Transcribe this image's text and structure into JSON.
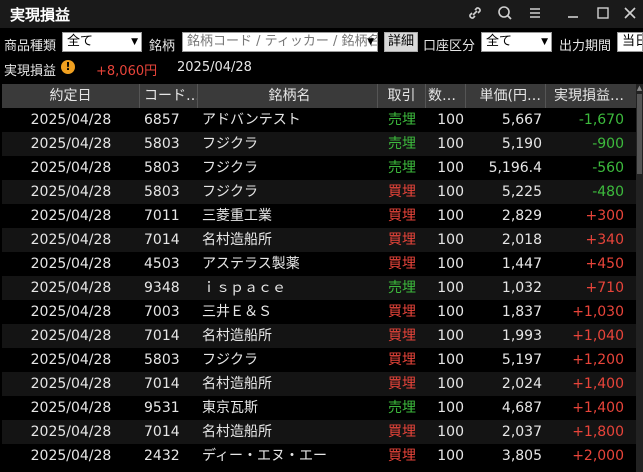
{
  "title": "実現損益",
  "filters": {
    "product_label": "商品種類",
    "product_value": "全て",
    "brand_label": "銘柄",
    "brand_placeholder": "銘柄コード / ティッカー / 銘柄名",
    "detail_button": "詳細",
    "account_label": "口座区分",
    "account_value": "全て",
    "period_label": "出力期間",
    "period_value": "当日"
  },
  "summary": {
    "label": "実現損益",
    "warning_glyph": "!",
    "value": "+8,060円",
    "date": "2025/04/28"
  },
  "columns": {
    "date": "約定日",
    "code": "コード…",
    "name": "銘柄名",
    "trade": "取引",
    "qty": "数…",
    "price": "単価(円…",
    "pl": "実現損益…"
  },
  "colors": {
    "sell": "#3dbb3d",
    "buy": "#e8443a",
    "loss": "#3dbb3d",
    "gain": "#e8443a"
  },
  "rows": [
    {
      "date": "2025/04/28",
      "code": "6857",
      "name": "アドバンテスト",
      "trade": "売埋",
      "qty": "100",
      "price": "5,667",
      "pl": "-1,670"
    },
    {
      "date": "2025/04/28",
      "code": "5803",
      "name": "フジクラ",
      "trade": "売埋",
      "qty": "100",
      "price": "5,190",
      "pl": "-900"
    },
    {
      "date": "2025/04/28",
      "code": "5803",
      "name": "フジクラ",
      "trade": "売埋",
      "qty": "100",
      "price": "5,196.4",
      "pl": "-560"
    },
    {
      "date": "2025/04/28",
      "code": "5803",
      "name": "フジクラ",
      "trade": "買埋",
      "qty": "100",
      "price": "5,225",
      "pl": "-480"
    },
    {
      "date": "2025/04/28",
      "code": "7011",
      "name": "三菱重工業",
      "trade": "買埋",
      "qty": "100",
      "price": "2,829",
      "pl": "+300"
    },
    {
      "date": "2025/04/28",
      "code": "7014",
      "name": "名村造船所",
      "trade": "買埋",
      "qty": "100",
      "price": "2,018",
      "pl": "+340"
    },
    {
      "date": "2025/04/28",
      "code": "4503",
      "name": "アステラス製薬",
      "trade": "買埋",
      "qty": "100",
      "price": "1,447",
      "pl": "+450"
    },
    {
      "date": "2025/04/28",
      "code": "9348",
      "name": "ｉｓｐａｃｅ",
      "trade": "売埋",
      "qty": "100",
      "price": "1,032",
      "pl": "+710"
    },
    {
      "date": "2025/04/28",
      "code": "7003",
      "name": "三井Ｅ＆Ｓ",
      "trade": "買埋",
      "qty": "100",
      "price": "1,837",
      "pl": "+1,030"
    },
    {
      "date": "2025/04/28",
      "code": "7014",
      "name": "名村造船所",
      "trade": "買埋",
      "qty": "100",
      "price": "1,993",
      "pl": "+1,040"
    },
    {
      "date": "2025/04/28",
      "code": "5803",
      "name": "フジクラ",
      "trade": "買埋",
      "qty": "100",
      "price": "5,197",
      "pl": "+1,200"
    },
    {
      "date": "2025/04/28",
      "code": "7014",
      "name": "名村造船所",
      "trade": "買埋",
      "qty": "100",
      "price": "2,024",
      "pl": "+1,400"
    },
    {
      "date": "2025/04/28",
      "code": "9531",
      "name": "東京瓦斯",
      "trade": "売埋",
      "qty": "100",
      "price": "4,687",
      "pl": "+1,400"
    },
    {
      "date": "2025/04/28",
      "code": "7014",
      "name": "名村造船所",
      "trade": "買埋",
      "qty": "100",
      "price": "2,037",
      "pl": "+1,800"
    },
    {
      "date": "2025/04/28",
      "code": "2432",
      "name": "ディー・エヌ・エー",
      "trade": "買埋",
      "qty": "100",
      "price": "3,805",
      "pl": "+2,000"
    }
  ]
}
